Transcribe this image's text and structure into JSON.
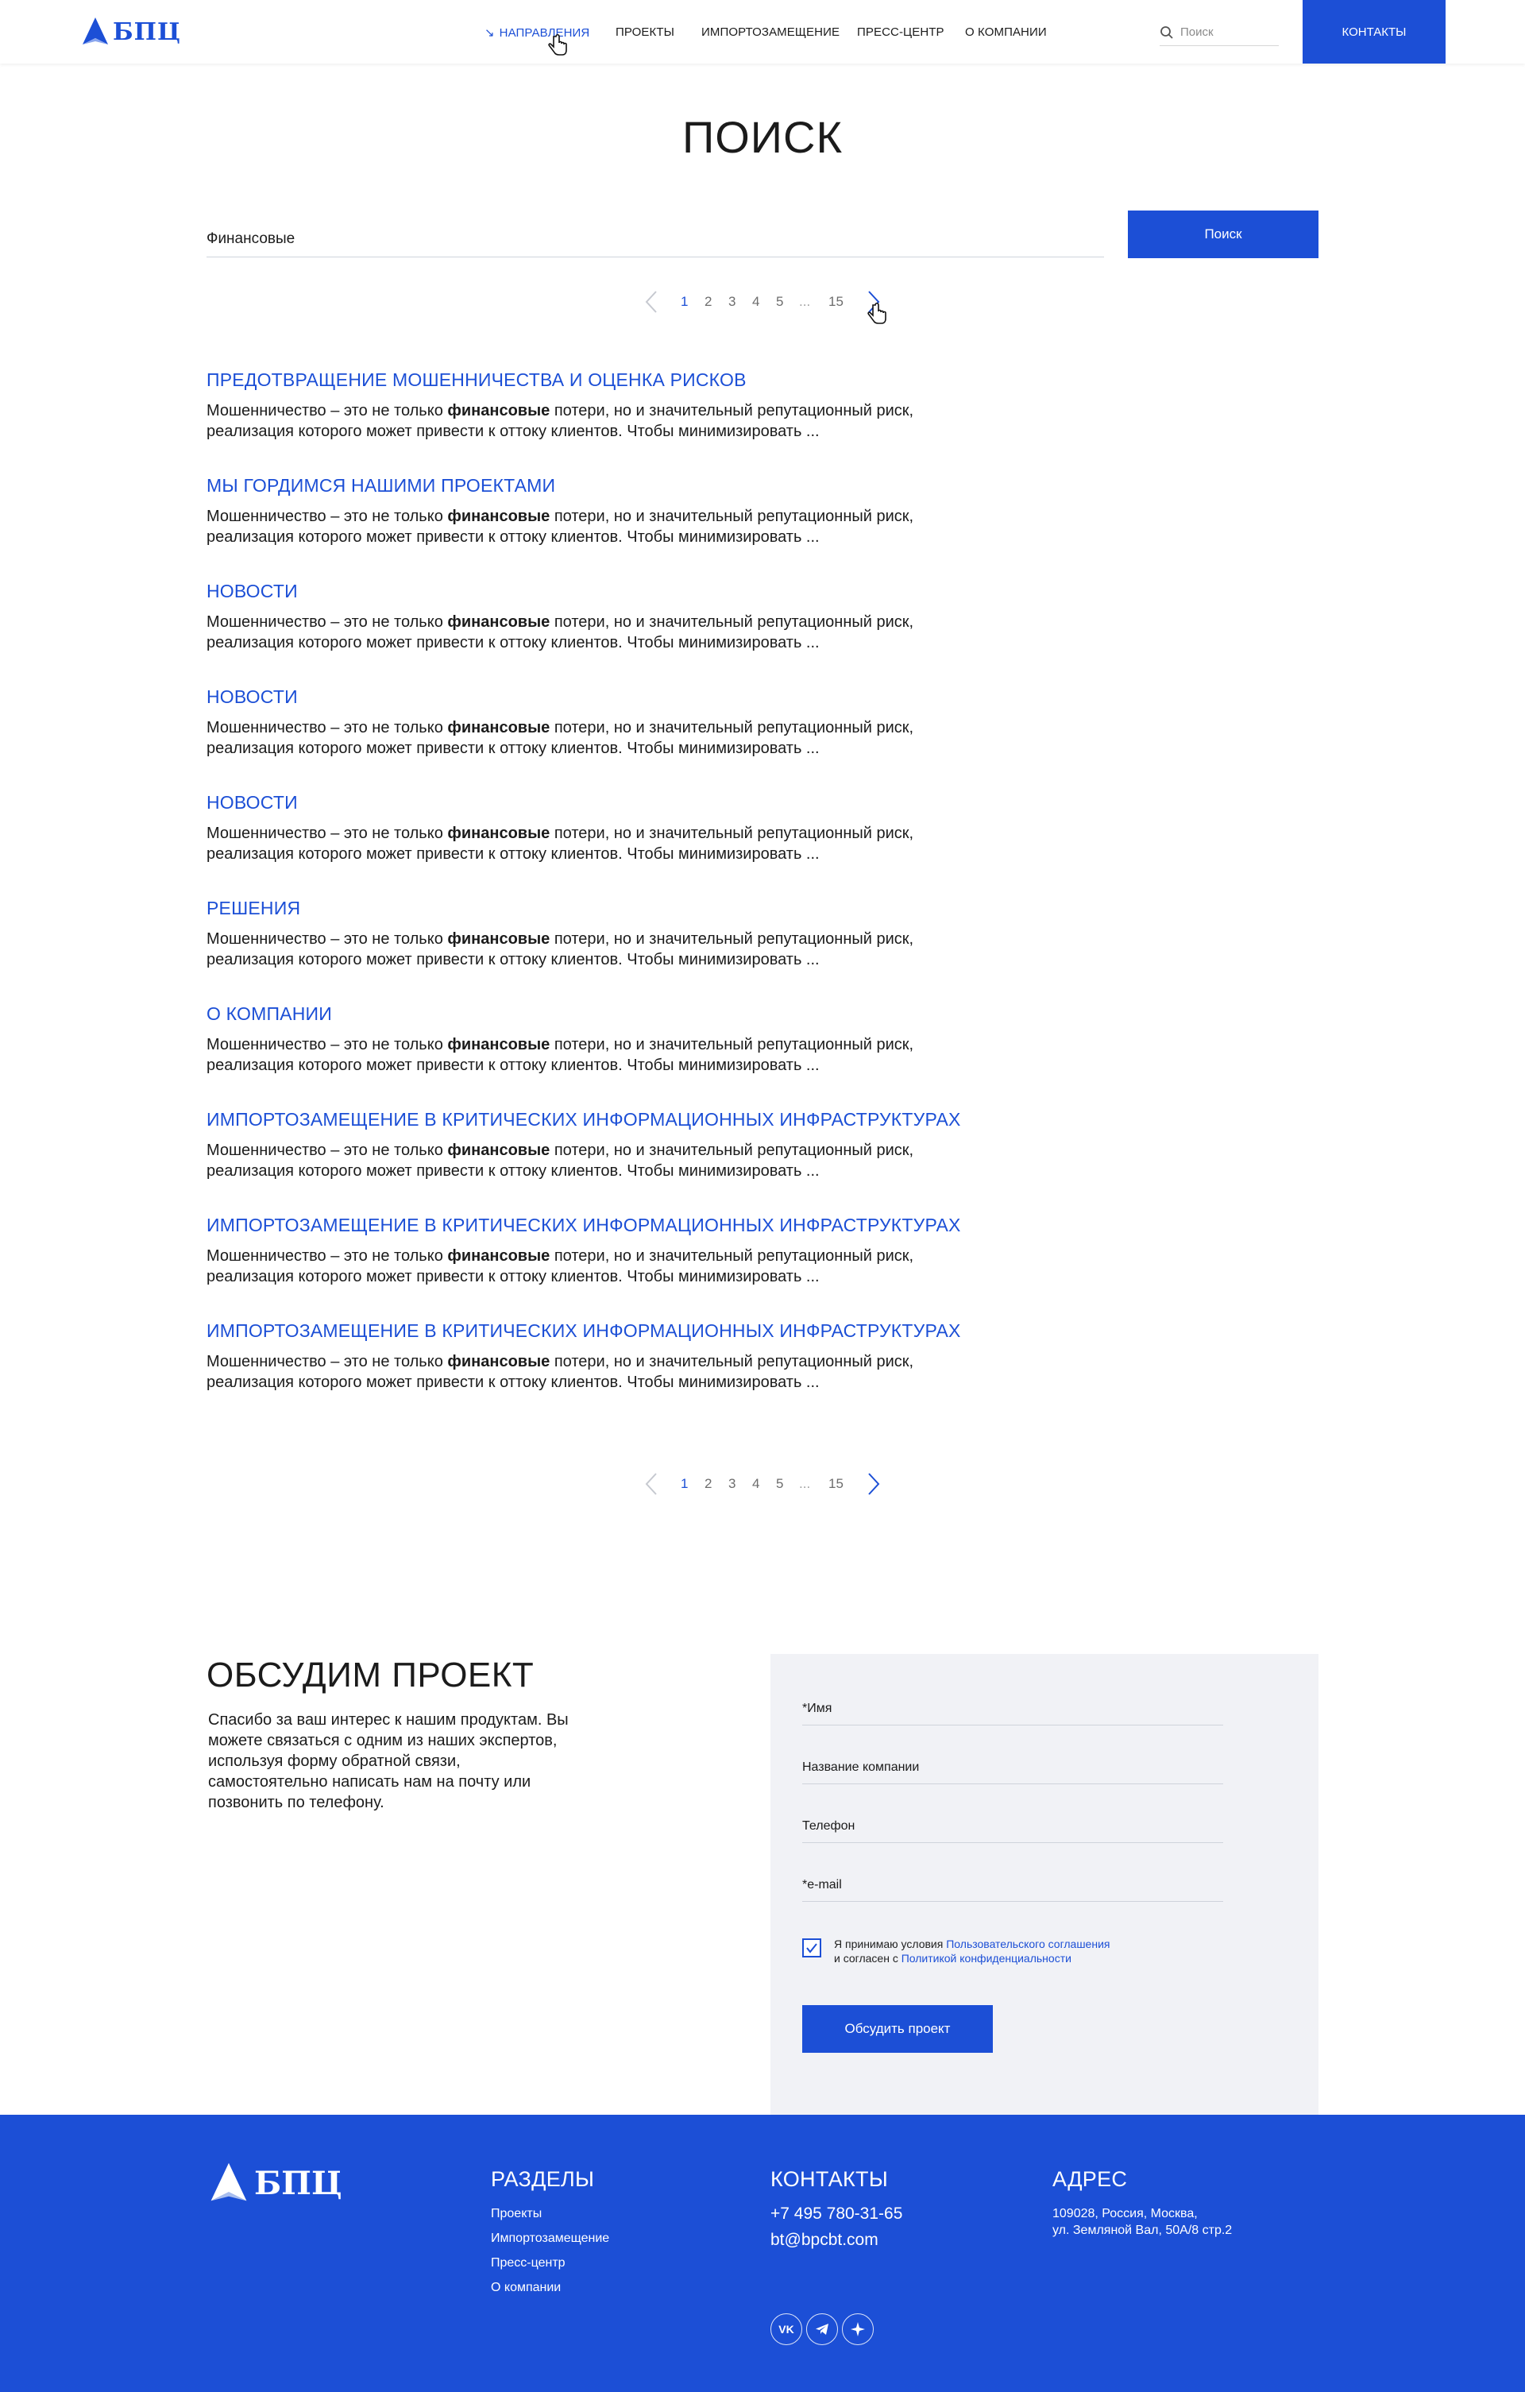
{
  "header": {
    "logo_text": "БПЦ",
    "nav": [
      {
        "label": "НАПРАВЛЕНИЯ",
        "active": true
      },
      {
        "label": "ПРОЕКТЫ"
      },
      {
        "label": "ИМПОРТОЗАМЕЩЕНИЕ"
      },
      {
        "label": "ПРЕСС-ЦЕНТР"
      },
      {
        "label": "О КОМПАНИИ"
      }
    ],
    "search_placeholder": "Поиск",
    "contacts_label": "КОНТАКТЫ"
  },
  "page_title": "ПОИСК",
  "search": {
    "value": "Финансовые",
    "button_label": "Поиск"
  },
  "pagination": {
    "pages": [
      "1",
      "2",
      "3",
      "4",
      "5",
      "...",
      "15"
    ],
    "current": "1"
  },
  "results": [
    {
      "title": "ПРЕДОТВРАЩЕНИЕ МОШЕННИЧЕСТВА И ОЦЕНКА РИСКОВ"
    },
    {
      "title": "МЫ ГОРДИМСЯ НАШИМИ ПРОЕКТАМИ"
    },
    {
      "title": "НОВОСТИ"
    },
    {
      "title": "НОВОСТИ"
    },
    {
      "title": "НОВОСТИ"
    },
    {
      "title": "РЕШЕНИЯ"
    },
    {
      "title": "О КОМПАНИИ"
    },
    {
      "title": "ИМПОРТОЗАМЕЩЕНИЕ В КРИТИЧЕСКИХ ИНФОРМАЦИОННЫХ ИНФРАСТРУКТУРАХ"
    },
    {
      "title": "ИМПОРТОЗАМЕЩЕНИЕ В КРИТИЧЕСКИХ ИНФОРМАЦИОННЫХ ИНФРАСТРУКТУРАХ"
    },
    {
      "title": "ИМПОРТОЗАМЕЩЕНИЕ В КРИТИЧЕСКИХ ИНФОРМАЦИОННЫХ ИНФРАСТРУКТУРАХ"
    }
  ],
  "snippet": {
    "before": "Мошенничество – это не только ",
    "highlight": "финансовые",
    "after_line1": " потери, но и значительный репутационный риск,",
    "line2": "реализация которого может привести к оттоку клиентов. Чтобы минимизировать ..."
  },
  "discuss": {
    "title": "ОБСУДИМ ПРОЕКТ",
    "text": "Спасибо за ваш интерес к нашим продуктам. Вы можете связаться с одним из наших экспертов, используя форму обратной связи, самостоятельно написать нам на почту или позвонить по телефону."
  },
  "form": {
    "name_label": "*Имя",
    "company_label": "Название компании",
    "phone_label": "Телефон",
    "email_label": "*e-mail",
    "consent_prefix": "Я принимаю условия ",
    "consent_link1": "Пользовательского соглашения",
    "consent_mid": "и согласен с ",
    "consent_link2": "Политикой конфиденциальности",
    "consent_checked": true,
    "submit_label": "Обсудить проект"
  },
  "footer": {
    "logo_text": "БПЦ",
    "sections_title": "РАЗДЕЛЫ",
    "sections": [
      "Проекты",
      "Импортозамещение",
      "Пресс-центр",
      "О компании"
    ],
    "contacts_title": "КОНТАКТЫ",
    "phone": "+7 495 780-31-65",
    "email": "bt@bpcbt.com",
    "address_title": "АДРЕС",
    "address_line1": "109028, Россия, Москва,",
    "address_line2": "ул. Земляной Вал, 50А/8 стр.2",
    "socials": [
      "vk-icon",
      "telegram-icon",
      "sparkle-icon"
    ]
  },
  "colors": {
    "accent": "#1c4fd6",
    "text": "#1b1b1b",
    "form_bg": "#f1f2f6"
  }
}
